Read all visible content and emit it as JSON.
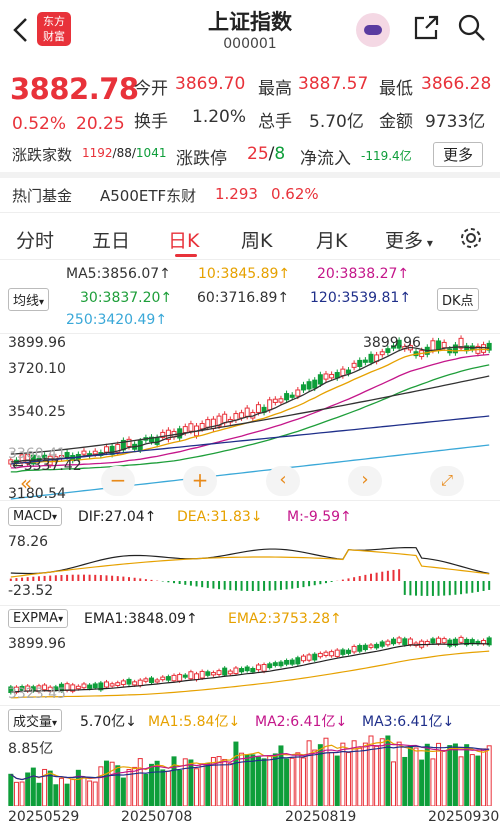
{
  "header": {
    "title": "上证指数",
    "code": "000001",
    "logo_line1": "东方",
    "logo_line2": "财富"
  },
  "quote": {
    "price": "3882.78",
    "pct": "0.52%",
    "chg": "20.25",
    "open_label": "今开",
    "open": "3869.70",
    "high_label": "最高",
    "high": "3887.57",
    "low_label": "最低",
    "low": "3866.28",
    "turnover_label": "换手",
    "turnover": "1.20%",
    "volume_label": "总手",
    "volume": "5.70亿",
    "amount_label": "金额",
    "amount": "9733亿",
    "breadth_label": "涨跌家数",
    "breadth_up": "1192",
    "breadth_flat": "88",
    "breadth_down": "1041",
    "limit_label": "涨跌停",
    "limit_up": "25",
    "limit_down": "8",
    "inflow_label": "净流入",
    "inflow": "-119.4亿",
    "more": "更多"
  },
  "fund": {
    "label": "热门基金",
    "name": "A500ETF东财",
    "price": "1.293",
    "pct": "0.62%"
  },
  "tabs": [
    "分时",
    "五日",
    "日K",
    "周K",
    "月K",
    "更多"
  ],
  "active_tab": "日K",
  "ma_panel": {
    "ma5": "MA5:3856.07↑",
    "ma10": "10:3845.89↑",
    "ma20": "20:3838.27↑",
    "ma30": "30:3837.20↑",
    "ma60": "60:3716.89↑",
    "ma120": "120:3539.81↑",
    "ma250": "250:3420.49↑",
    "selector": "均线",
    "dk": "DK点"
  },
  "kline_axis": {
    "top": "3899.96",
    "l2": "3720.10",
    "l3": "3540.25",
    "l4": "3360.41",
    "bottom": "3180.54",
    "max_mark": "3899.96",
    "min_mark": "3337.42"
  },
  "macd": {
    "selector": "MACD",
    "dif": "DIF:27.04↑",
    "dea": "DEA:31.83↓",
    "m": "M:-9.59↑",
    "top": "78.26",
    "bottom": "-23.52"
  },
  "expma": {
    "selector": "EXPMA",
    "ema1": "EMA1:3848.09↑",
    "ema2": "EMA2:3753.28↑",
    "top": "3899.96",
    "bottom": "3323.45"
  },
  "vol": {
    "selector": "成交量",
    "value": "5.70亿↓",
    "ma1": "MA1:5.84亿↓",
    "ma2": "MA2:6.41亿↓",
    "ma3": "MA3:6.41亿↓",
    "top": "8.85亿"
  },
  "dates": [
    "20250529",
    "20250708",
    "20250819",
    "20250930"
  ],
  "colors": {
    "up": "#e8323a",
    "down": "#0e9e3a",
    "ma5": "#333333",
    "ma10": "#e6a100",
    "ma20": "#c4168a",
    "ma30": "#1e9e3a",
    "ma60": "#333333",
    "ma120": "#1f2f8a",
    "ma250": "#3aa8d8"
  }
}
